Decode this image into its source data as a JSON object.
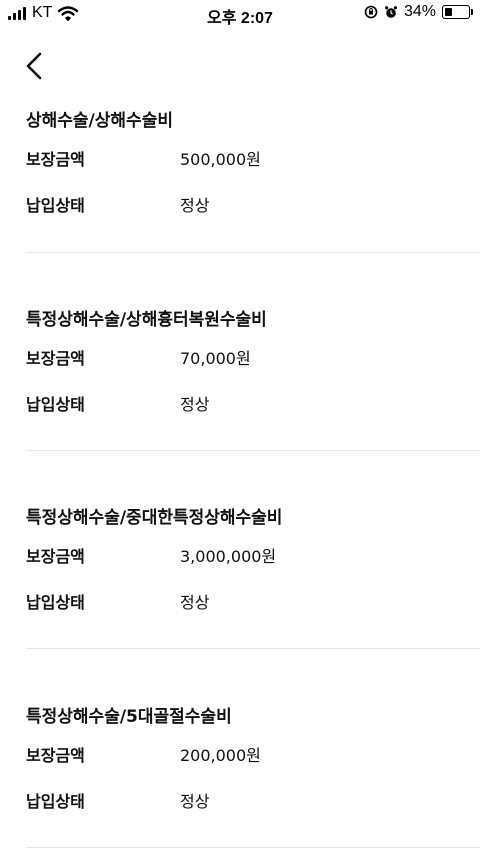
{
  "status_bar": {
    "carrier": "KT",
    "time": "오후 2:07",
    "battery_percent": "34%",
    "battery_level": 0.34,
    "icons": [
      "signal-icon",
      "wifi-icon",
      "orientation-lock-icon",
      "alarm-icon",
      "battery-icon"
    ]
  },
  "nav": {
    "back_icon": "chevron-left-icon"
  },
  "sections": [
    {
      "title": "상해수술/상해수술비",
      "rows": [
        {
          "label": "보장금액",
          "value": "500,000원"
        },
        {
          "label": "납입상태",
          "value": "정상"
        }
      ]
    },
    {
      "title": "특정상해수술/상해흉터복원수술비",
      "rows": [
        {
          "label": "보장금액",
          "value": "70,000원"
        },
        {
          "label": "납입상태",
          "value": "정상"
        }
      ]
    },
    {
      "title": "특정상해수술/중대한특정상해수술비",
      "rows": [
        {
          "label": "보장금액",
          "value": "3,000,000원"
        },
        {
          "label": "납입상태",
          "value": "정상"
        }
      ]
    },
    {
      "title": "특정상해수술/5대골절수술비",
      "rows": [
        {
          "label": "보장금액",
          "value": "200,000원"
        },
        {
          "label": "납입상태",
          "value": "정상"
        }
      ]
    }
  ]
}
